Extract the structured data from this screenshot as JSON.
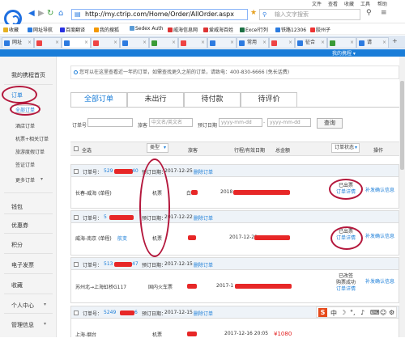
{
  "browser": {
    "menu": [
      "文件",
      "查看",
      "收藏",
      "工具",
      "帮助"
    ],
    "url": "http://my.ctrip.com/Home/Order/AllOrder.aspx",
    "search_placeholder": "输入文字搜索",
    "bookmarks": [
      "收藏",
      "网址导航",
      "百度翻译",
      "我的搜狐",
      "Sedex Auth",
      "威海信息网",
      "爱威海百姓",
      "Excel行列",
      "铁路12306",
      "胶州子"
    ],
    "tabs": [
      "网址",
      "",
      "",
      "",
      "",
      "",
      "",
      "",
      "常用",
      "",
      "征合",
      "",
      "请"
    ]
  },
  "ctrip_top": {
    "mytrip_link": "我的携程 ▾"
  },
  "sidebar": {
    "items": [
      "我的携程首页",
      "订单",
      "积分",
      "优惠券",
      "积分",
      "电子发票",
      "收藏",
      "个人中心",
      "管理信息"
    ],
    "orders": "订单",
    "sub_items": [
      "全部订单",
      "酒店订单",
      "机票+相关订单",
      "旅游度假订单",
      "签证订单",
      "更多订单"
    ],
    "other": [
      "我的携程首页",
      "钱包",
      "优惠券",
      "积分",
      "电子发票",
      "收藏",
      "个人中心",
      "管理信息"
    ]
  },
  "notice": "您可以在这里查看近一年的订单，如需查找更久之前的订单，请致电：400-830-6666 (免长话费)",
  "order_tabs": [
    "全部订单",
    "未出行",
    "待付款",
    "待评价"
  ],
  "filters": {
    "order_no_label": "订单号",
    "traveler_label": "旅客",
    "traveler_placeholder": "中文名/英文名",
    "date_label": "预订日期",
    "date_from": "yyyy-mm-dd",
    "date_to": "yyyy-mm-dd",
    "query_button": "查询"
  },
  "table_header": {
    "select_all": "全选",
    "type": "类型",
    "traveler": "旅客",
    "trip": "行程/有效日期",
    "total": "总金额",
    "status": "订单状态",
    "action": "操作"
  },
  "orders": [
    {
      "no_prefix": "订单号：",
      "no_start": "529",
      "no_end": "40",
      "date_label": "预订日期：",
      "date": "2017-12-25",
      "delete": "删除订单",
      "route": "长春-威海 (单程)",
      "type": "机票",
      "traveler_prefix": "白",
      "trip_prefix": "2018",
      "status_lines": [
        "已出票",
        "订单详情"
      ],
      "action": "补发确认信息"
    },
    {
      "no_prefix": "订单号：",
      "no_start": "5",
      "no_end": "",
      "date_label": "预订日期：",
      "date": "2017-12-22",
      "delete": "删除订单",
      "route": "威海-南京 (单程)",
      "sub": "航变",
      "type": "机票",
      "traveler_prefix": "",
      "trip_prefix": "2017-12-29",
      "status_lines": [
        "已出票",
        "订单详情"
      ],
      "action": "补发确认信息"
    },
    {
      "no_prefix": "订单号：",
      "no_start": "513",
      "no_end": "47",
      "date_label": "预订日期：",
      "date": "2017-12-15",
      "delete": "删除订单",
      "route": "苏州北→上海虹桥G117",
      "type": "国内火车票",
      "traveler_prefix": "",
      "trip_prefix": "2017-1",
      "status_lines": [
        "已改签",
        "购票成功",
        "订单详情"
      ],
      "action": "补发确认信息"
    },
    {
      "no_prefix": "订单号：",
      "no_start": "5249",
      "no_end": "6",
      "date_label": "预订日期：",
      "date": "2017-12-15",
      "delete": "删除订单",
      "route": "上海-烟台",
      "type": "机票",
      "traveler_prefix": "",
      "trip_prefix": "2017-12-16 20:05",
      "amount": "¥1080",
      "status_lines": [],
      "action": ""
    }
  ],
  "ime_label": "S"
}
